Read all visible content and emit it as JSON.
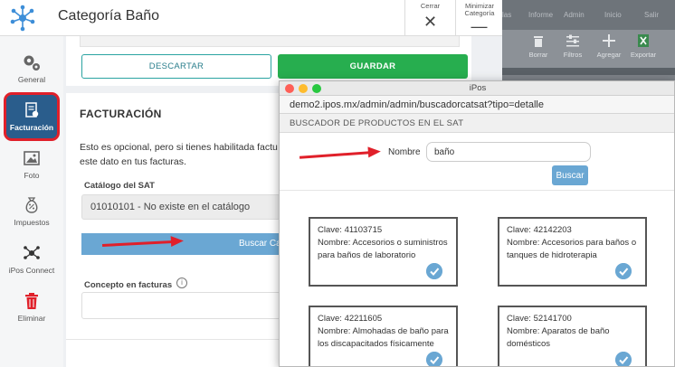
{
  "app": {
    "title": "Categoría Baño",
    "close_label": "Cerrar",
    "close_glyph": "✕",
    "minimize_label": "Minimizar Categoría",
    "minimize_glyph": "—"
  },
  "background_app": {
    "top_labels": [
      "las",
      "Informe",
      "Admin",
      "Inicio",
      "Salir"
    ],
    "tools": [
      {
        "label": "Borrar",
        "icon": "trash-icon"
      },
      {
        "label": "Filtros",
        "icon": "sliders-icon"
      },
      {
        "label": "Agregar",
        "icon": "plus-icon"
      },
      {
        "label": "Exportar",
        "icon": "excel-icon"
      }
    ]
  },
  "sidebar": {
    "items": [
      {
        "label": "General",
        "icon": "gears-icon"
      },
      {
        "label": "Facturación",
        "icon": "invoice-icon",
        "active": true
      },
      {
        "label": "Foto",
        "icon": "photo-icon"
      },
      {
        "label": "Impuestos",
        "icon": "money-bag-icon"
      },
      {
        "label": "iPos Connect",
        "icon": "network-icon"
      },
      {
        "label": "Eliminar",
        "icon": "trash-icon"
      }
    ]
  },
  "actions": {
    "discard_label": "DESCARTAR",
    "save_label": "GUARDAR"
  },
  "facturacion": {
    "title": "FACTURACIÓN",
    "description_line1": "Esto es opcional, pero si tienes habilitada factu",
    "description_line2": "este dato en tus facturas.",
    "catalog_label": "Catálogo del SAT",
    "catalog_value": "01010101 - No existe en el catálogo",
    "search_catalog_button": "Buscar Ca",
    "concept_label": "Concepto en facturas",
    "info_glyph": "i",
    "concept_value": ""
  },
  "popup": {
    "window_title": "iPos",
    "url": "demo2.ipos.mx/admin/admin/buscadorcatsat?tipo=detalle",
    "header": "BUSCADOR DE PRODUCTOS EN EL SAT",
    "name_label": "Nombre",
    "name_value": "baño",
    "search_button": "Buscar",
    "results": [
      {
        "clave": "Clave: 41103715",
        "nombre": "Nombre: Accesorios o suministros para baños de laboratorio"
      },
      {
        "clave": "Clave: 42142203",
        "nombre": "Nombre: Accesorios para baños o tanques de hidroterapia"
      },
      {
        "clave": "Clave: 42211605",
        "nombre": "Nombre: Almohadas de baño para los discapacitados físicamente"
      },
      {
        "clave": "Clave: 52141700",
        "nombre": "Nombre: Aparatos de baño domésticos"
      }
    ]
  },
  "colors": {
    "accent_blue": "#6aa7d3",
    "save_green": "#27ae4f",
    "active_sidebar": "#2a5d8c",
    "highlight_red": "#e0202a"
  }
}
